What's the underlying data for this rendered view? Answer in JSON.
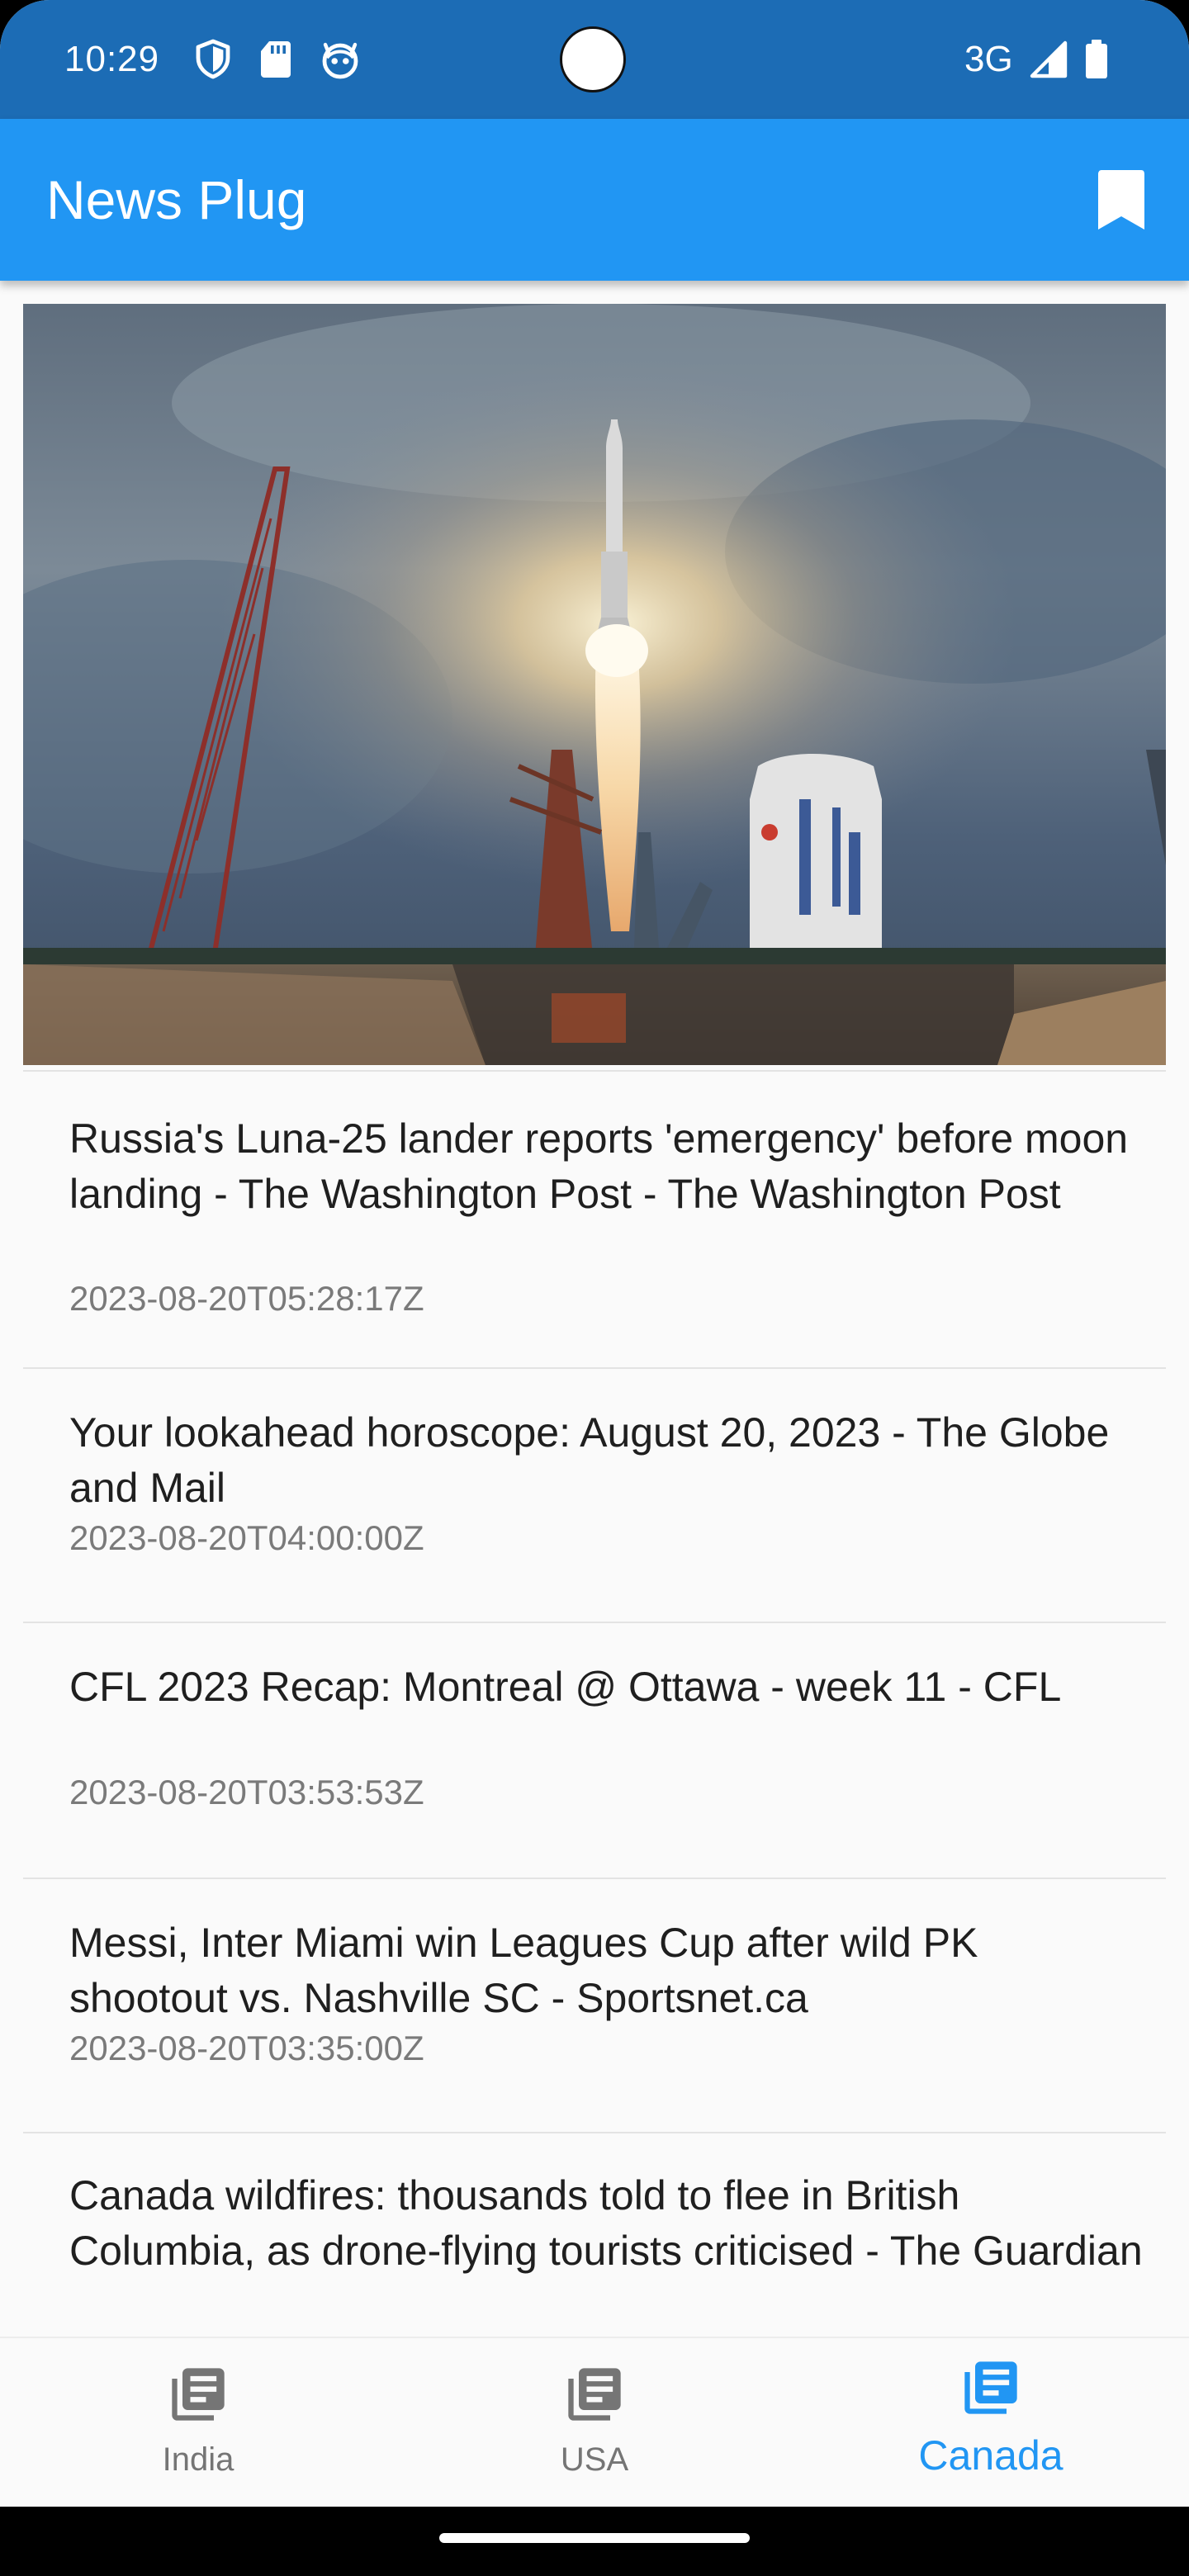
{
  "status_bar": {
    "time": "10:29",
    "network": "3G",
    "icons": [
      "shield-icon",
      "sd-card-icon",
      "bot-face-icon",
      "signal-icon",
      "battery-icon"
    ]
  },
  "app_bar": {
    "title": "News Plug",
    "bookmark_icon": "bookmark-icon",
    "color": "#2196f3"
  },
  "hero": {
    "description_icon": "rocket-launch-photo"
  },
  "articles": [
    {
      "title": "Russia's Luna-25 lander reports 'emergency' before moon landing - The Washington Post - The Washington Post",
      "date": "2023-08-20T05:28:17Z"
    },
    {
      "title": "Your lookahead horoscope: August 20, 2023 - The Globe and Mail",
      "date": "2023-08-20T04:00:00Z"
    },
    {
      "title": "CFL 2023 Recap: Montreal @ Ottawa - week 11 - CFL",
      "date": "2023-08-20T03:53:53Z"
    },
    {
      "title": "Messi, Inter Miami win Leagues Cup after wild PK shootout vs. Nashville SC - Sportsnet.ca",
      "date": "2023-08-20T03:35:00Z"
    },
    {
      "title": "Canada wildfires: thousands told to flee in British Columbia, as drone-flying tourists criticised - The Guardian",
      "date": ""
    }
  ],
  "bottom_nav": {
    "items": [
      {
        "label": "India",
        "icon": "newspaper-icon",
        "active": false
      },
      {
        "label": "USA",
        "icon": "newspaper-icon",
        "active": false
      },
      {
        "label": "Canada",
        "icon": "newspaper-icon",
        "active": true
      }
    ],
    "active_color": "#2196f3",
    "inactive_color": "#757575"
  }
}
